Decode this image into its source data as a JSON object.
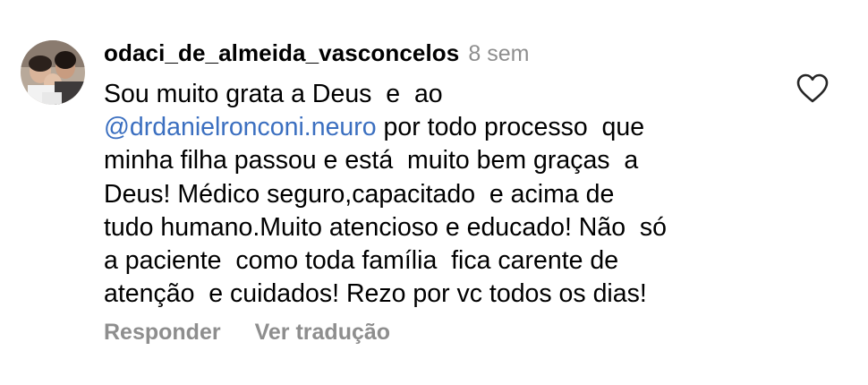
{
  "comment": {
    "username": "odaci_de_almeida_vasconcelos",
    "time": "8 sem",
    "lines": {
      "l1": "Sou muito grata a Deus  e  ao",
      "l2_mention": "@drdanielronconi.neuro",
      "l2_rest": " por todo processo  que",
      "l3": "minha filha passou e está  muito bem graças  a",
      "l4": "Deus! Médico seguro,capacitado  e acima de",
      "l5": "tudo humano.Muito atencioso e educado! Não  só",
      "l6": "a paciente  como toda família  fica carente de",
      "l7": "atenção  e cuidados! Rezo por vc todos os dias!"
    },
    "actions": {
      "reply": "Responder",
      "translate": "Ver tradução"
    },
    "like_icon": "heart-outline-icon"
  },
  "colors": {
    "text": "#000000",
    "muted": "#8e8e8e",
    "mention": "#3b6fc0",
    "background": "#ffffff"
  }
}
